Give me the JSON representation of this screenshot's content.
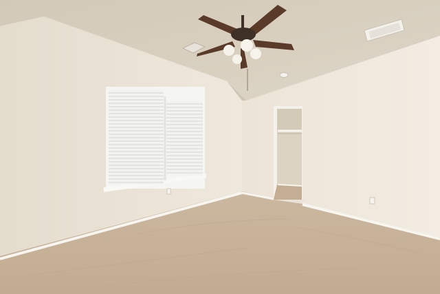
{
  "scene": {
    "subject": "empty-bedroom",
    "elements": [
      "ceiling",
      "left-wall",
      "right-wall",
      "window-with-blinds",
      "closet-doorway",
      "ceiling-fan",
      "air-vent",
      "smoke-detector",
      "carpet-floor",
      "baseboards",
      "electrical-outlets"
    ]
  },
  "colors": {
    "ceiling": "#d9d0c1",
    "ceiling_shadow": "#c9bfae",
    "wall_left": "#ece5d8",
    "wall_right": "#efe8dc",
    "wall_back": "#e6dccd",
    "closet_interior": "#ddd4c2",
    "carpet": "#c8b49b",
    "carpet_dark": "#b9a387",
    "baseboard": "#f7f5f0",
    "window_frame": "#f5f5f2",
    "blinds": "#f2f2f0",
    "blind_line": "#d6d6d2",
    "fan_blade": "#5a3a28",
    "fan_body": "#3e2f27",
    "fan_light": "#f6f3ea"
  }
}
